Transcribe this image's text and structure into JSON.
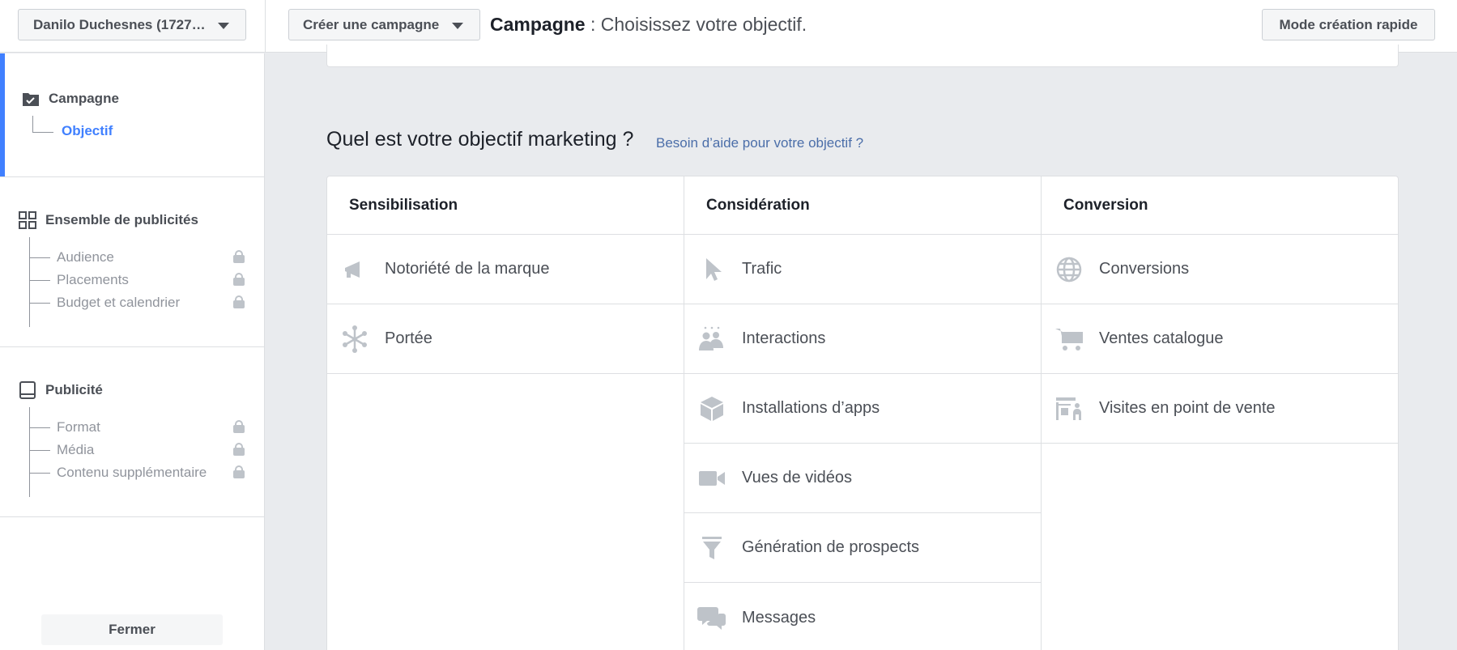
{
  "header": {
    "account_label": "Danilo Duchesnes (1727…",
    "create_label": "Créer une campagne",
    "title_bold": "Campagne",
    "title_rest": " : Choisissez votre objectif.",
    "quick_mode_label": "Mode création rapide"
  },
  "sidebar": {
    "campaign": {
      "label": "Campagne",
      "child": "Objectif"
    },
    "adset": {
      "label": "Ensemble de publicités",
      "items": [
        "Audience",
        "Placements",
        "Budget et calendrier"
      ]
    },
    "ad": {
      "label": "Publicité",
      "items": [
        "Format",
        "Média",
        "Contenu supplémentaire"
      ]
    },
    "close_label": "Fermer"
  },
  "main": {
    "question": "Quel est votre objectif marketing ?",
    "help_link": "Besoin d’aide pour votre objectif ?",
    "columns": [
      {
        "title": "Sensibilisation",
        "items": [
          "Notoriété de la marque",
          "Portée"
        ]
      },
      {
        "title": "Considération",
        "items": [
          "Trafic",
          "Interactions",
          "Installations d’apps",
          "Vues de vidéos",
          "Génération de prospects",
          "Messages"
        ]
      },
      {
        "title": "Conversion",
        "items": [
          "Conversions",
          "Ventes catalogue",
          "Visites en point de vente"
        ]
      }
    ]
  },
  "colors": {
    "accent": "#4080ff",
    "icon": "#bec3c9",
    "link": "#4b6ea9",
    "background": "#e9ebee"
  }
}
